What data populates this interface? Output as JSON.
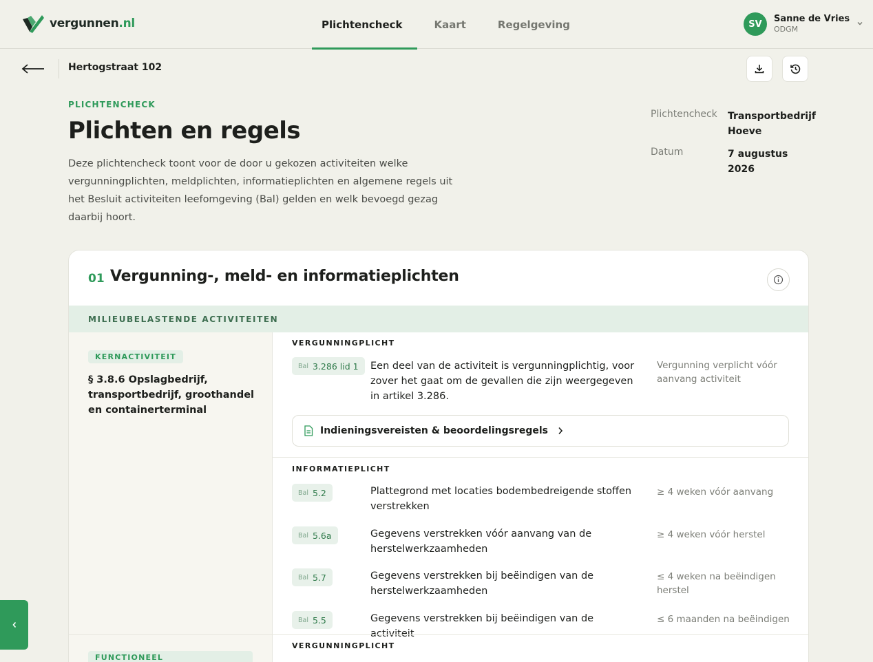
{
  "brand": {
    "name": "vergunnen",
    "tld": ".nl",
    "accent": "#2f9a5a"
  },
  "nav": {
    "tabs": [
      {
        "label": "Plichtencheck",
        "active": true
      },
      {
        "label": "Kaart",
        "active": false
      },
      {
        "label": "Regelgeving",
        "active": false
      }
    ]
  },
  "user": {
    "initials": "SV",
    "name": "Sanne de Vries",
    "org": "ODGM"
  },
  "subheader": {
    "breadcrumb": "Hertogstraat 102"
  },
  "intro": {
    "eyebrow": "PLICHTENCHECK",
    "title": "Plichten en regels",
    "description": "Deze plichtencheck toont voor de door u gekozen activiteiten welke vergunningplichten, meldplichten, informatieplichten en algemene regels uit het Besluit activiteiten leefomgeving (Bal) gelden en welk bevoegd gezag daarbij hoort."
  },
  "meta": [
    {
      "key": "Plichtencheck",
      "value": "Transportbedrijf Hoeve"
    },
    {
      "key": "Datum",
      "value": "7 augustus 2026"
    }
  ],
  "card": {
    "number": "01",
    "title": "Vergunning-, meld- en informatieplichten",
    "section": "MILIEUBELASTENDE ACTIVITEITEN",
    "activity": {
      "tag": "KERNACTIVITEIT",
      "title": "§ 3.8.6 Opslagbedrijf, transportbedrijf, groothandel en containerterminal"
    },
    "next_activity_tag": "FUNCTIONEEL ONDERSTEUNEND",
    "groups": [
      {
        "label": "VERGUNNINGPLICHT",
        "items": [
          {
            "prefix": "Bal",
            "ref": "3.286 lid 1",
            "text": "Een deel van de activiteit is vergunningplichtig, voor zover het gaat om de gevallen die zijn weergegeven in artikel 3.286.",
            "when": "Vergunning verplicht vóór aanvang activiteit"
          }
        ],
        "link": "Indieningsvereisten & beoordelingsregels"
      },
      {
        "label": "INFORMATIEPLICHT",
        "items": [
          {
            "prefix": "Bal",
            "ref": "5.2",
            "text": "Plattegrond met locaties bodembedreigende stoffen verstrekken",
            "when": "≥ 4 weken vóór aanvang"
          },
          {
            "prefix": "Bal",
            "ref": "5.6a",
            "text": "Gegevens verstrekken vóór aanvang van de herstelwerkzaamheden",
            "when": "≥ 4 weken vóór herstel"
          },
          {
            "prefix": "Bal",
            "ref": "5.7",
            "text": "Gegevens verstrekken bij beëindigen van de herstelwerkzaamheden",
            "when": "≤ 4 weken na beëindigen herstel"
          },
          {
            "prefix": "Bal",
            "ref": "5.5",
            "text": "Gegevens verstrekken bij beëindigen van de activiteit",
            "when": "≤ 6 maanden na beëindigen"
          }
        ]
      },
      {
        "label": "VERGUNNINGPLICHT"
      }
    ]
  },
  "icons": {
    "back": "arrow-left-icon",
    "download": "download-icon",
    "history": "history-icon",
    "info": "info-icon",
    "document": "document-icon",
    "chevron": "chevron-right-icon",
    "side": "chevron-left-icon"
  }
}
